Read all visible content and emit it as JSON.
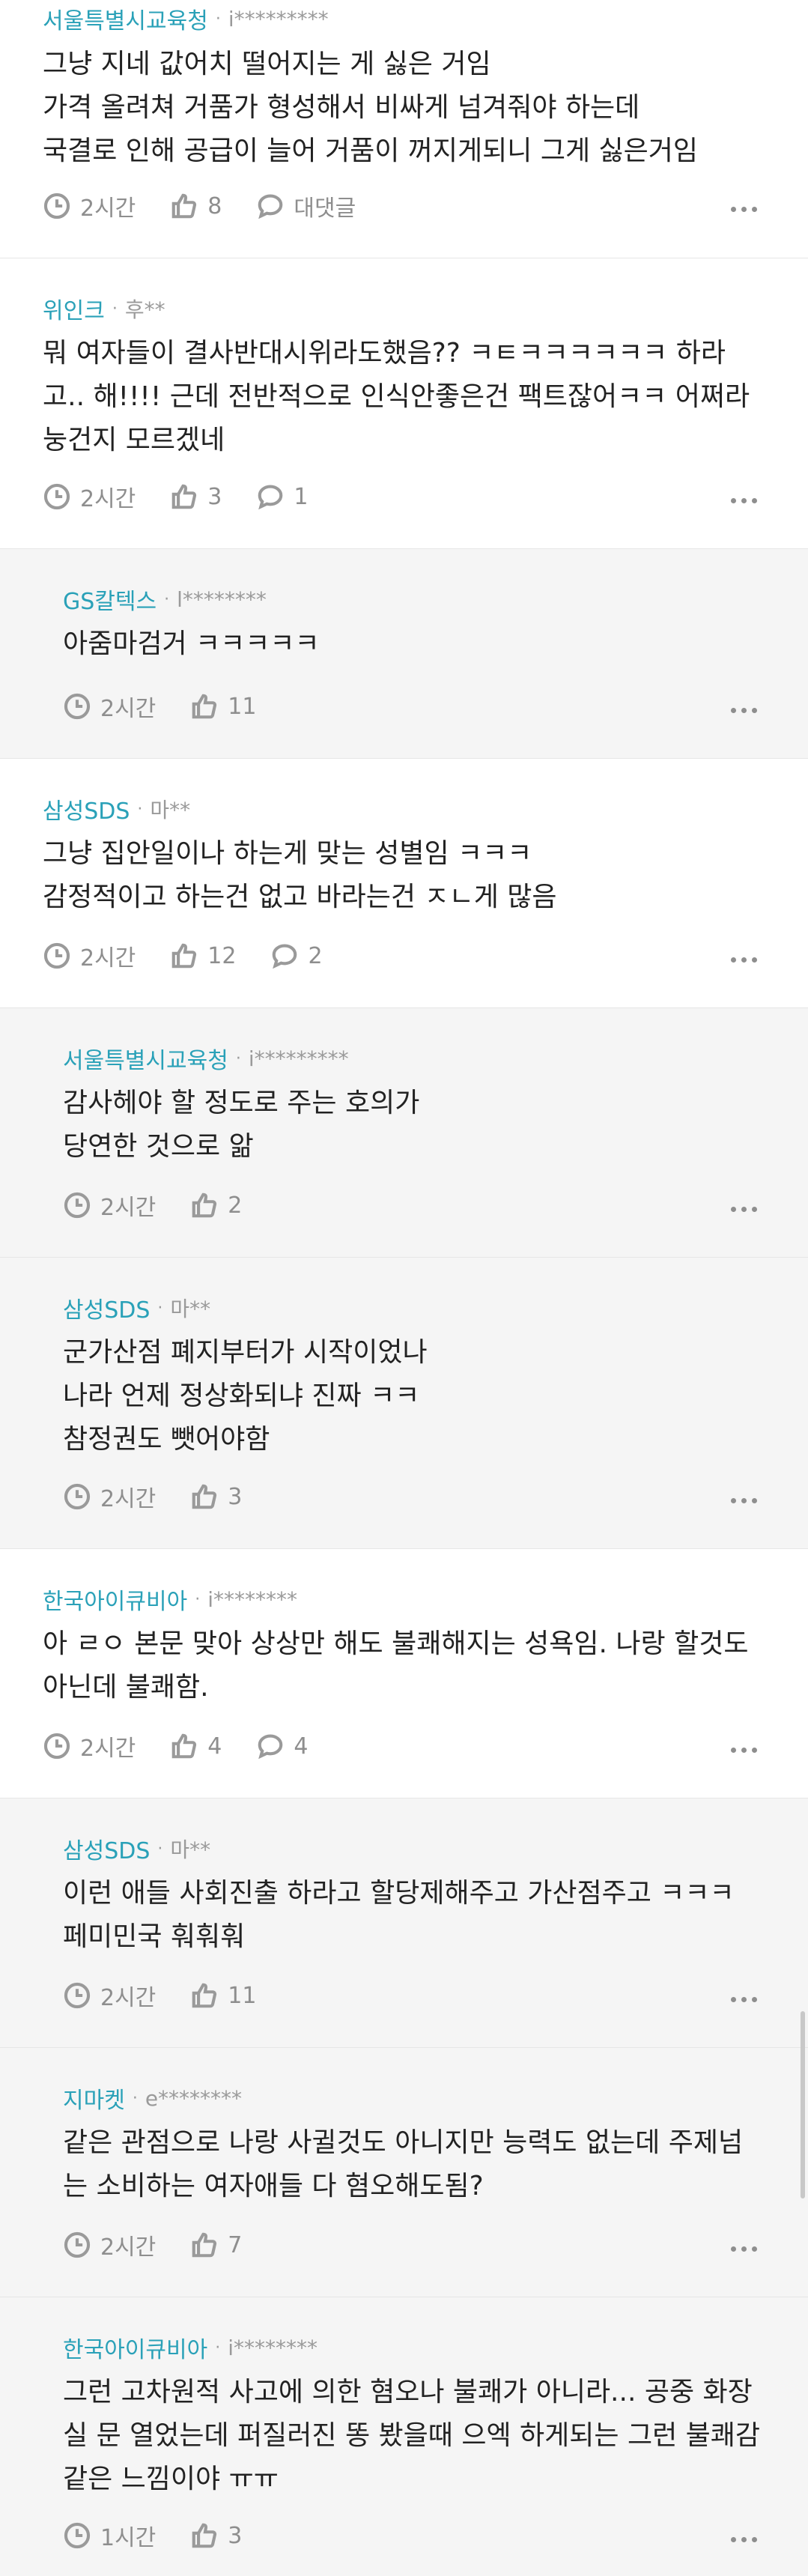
{
  "labels": {
    "reply_label": "대댓글"
  },
  "comments": [
    {
      "company": "서울특별시교육청",
      "user": "i*********",
      "text": "그냥 지네 값어치 떨어지는 게 싫은 거임\n가격 올려쳐 거품가 형성해서 비싸게 넘겨줘야 하는데\n국결로 인해 공급이 늘어 거품이 꺼지게되니 그게 싫은거임",
      "time": "2시간",
      "likes": "8",
      "replies": "대댓글"
    },
    {
      "company": "위인크",
      "user": "후**",
      "text": "뭐 여자들이 결사반대시위라도했음?? ㅋㅌㅋㅋㅋㅋㅋㅋ 하라고.. 해!!!! 근데 전반적으로 인식안좋은건 팩트잖어ㅋㅋ 어쩌라눙건지 모르겠네",
      "time": "2시간",
      "likes": "3",
      "replies": "1"
    },
    {
      "company": "GS칼텍스",
      "user": "l********",
      "text": "아줌마검거 ㅋㅋㅋㅋㅋ",
      "time": "2시간",
      "likes": "11"
    },
    {
      "company": "삼성SDS",
      "user": "마**",
      "text": "그냥 집안일이나 하는게 맞는 성별임 ㅋㅋㅋ\n감정적이고 하는건 없고 바라는건 ㅈㄴ게 많음",
      "time": "2시간",
      "likes": "12",
      "replies": "2"
    },
    {
      "company": "서울특별시교육청",
      "user": "i*********",
      "text": "감사헤야 할 정도로 주는 호의가\n당연한 것으로 앎",
      "time": "2시간",
      "likes": "2"
    },
    {
      "company": "삼성SDS",
      "user": "마**",
      "text": "군가산점 폐지부터가 시작이었나\n나라 언제 정상화되냐 진짜 ㅋㅋ\n참정권도 뺏어야함",
      "time": "2시간",
      "likes": "3"
    },
    {
      "company": "한국아이큐비아",
      "user": "i********",
      "text": "아 ㄹㅇ 본문 맞아 상상만 해도 불쾌해지는 성욕임. 나랑 할것도 아닌데 불쾌함.",
      "time": "2시간",
      "likes": "4",
      "replies": "4"
    },
    {
      "company": "삼성SDS",
      "user": "마**",
      "text": "이런 애들 사회진출 하라고 할당제해주고 가산점주고 ㅋㅋㅋ 페미민국 훠훠훠",
      "time": "2시간",
      "likes": "11"
    },
    {
      "company": "지마켓",
      "user": "e********",
      "text": "같은 관점으로 나랑 사귈것도 아니지만 능력도 없는데 주제넘는 소비하는 여자애들 다 혐오해도됨?",
      "time": "2시간",
      "likes": "7"
    },
    {
      "company": "한국아이큐비아",
      "user": "i********",
      "text": "그런 고차원적 사고에 의한 혐오나 불쾌가 아니라... 공중 화장실 문 열었는데 퍼질러진 똥 봤을때 으엑 하게되는 그런 불쾌감 같은 느낌이야 ㅠㅠ",
      "time": "1시간",
      "likes": "3"
    }
  ]
}
